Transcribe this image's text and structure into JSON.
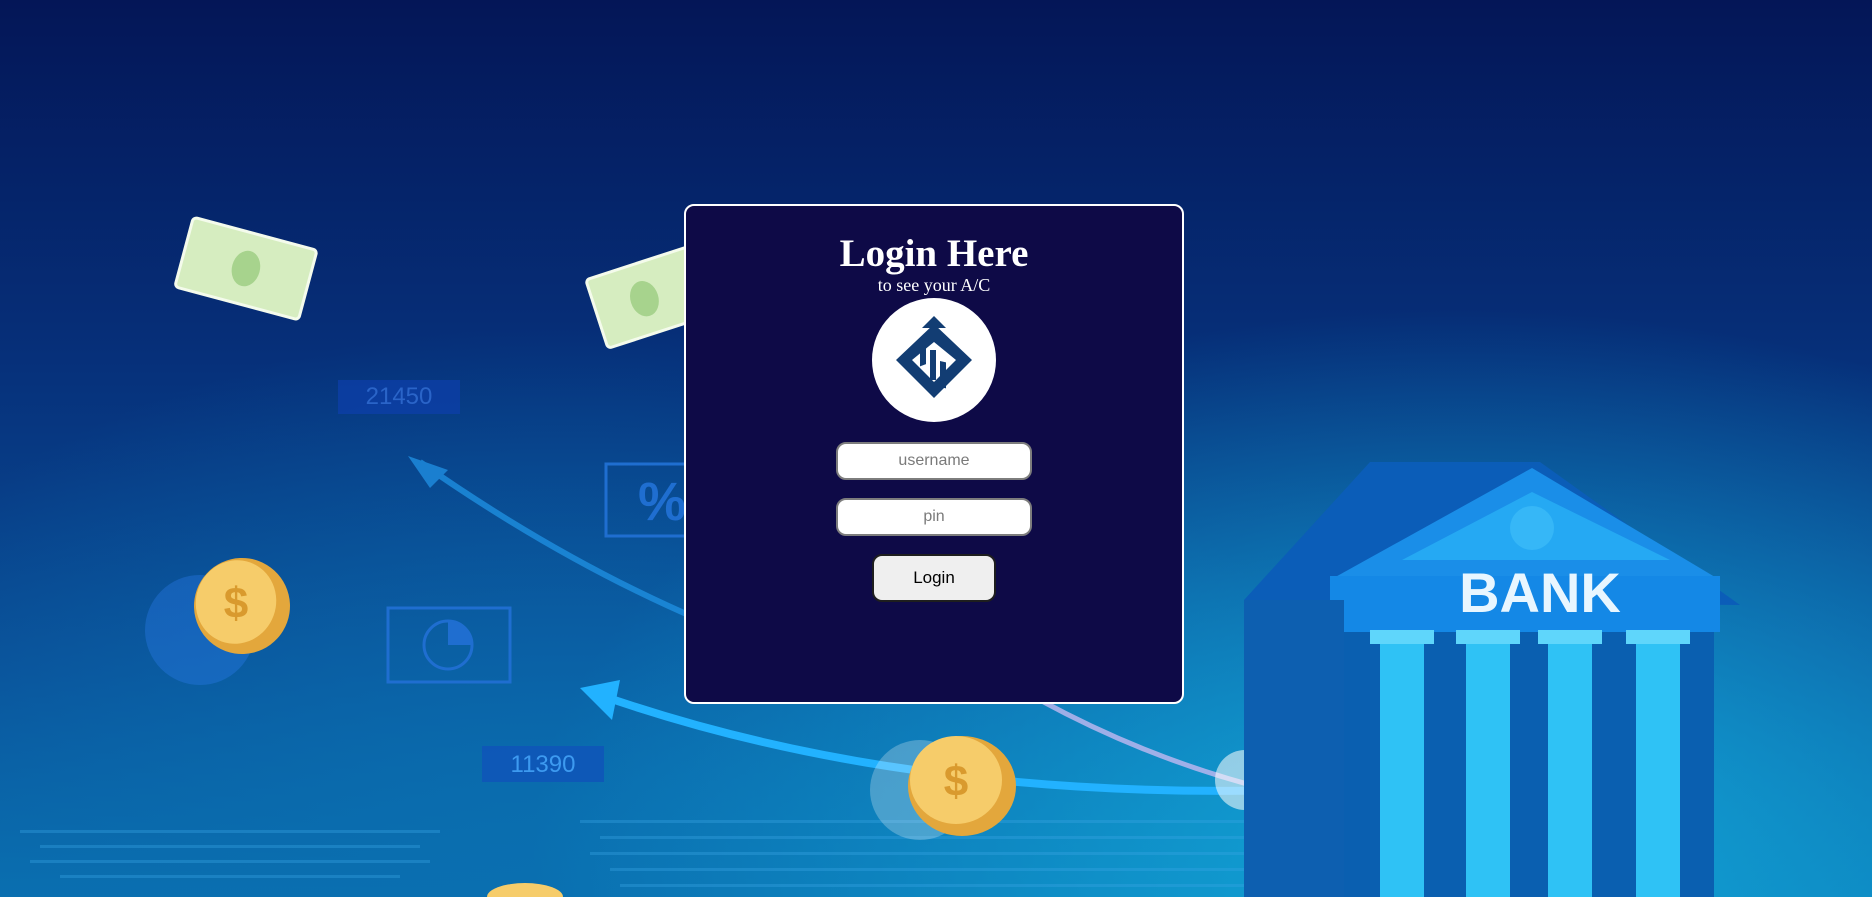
{
  "background": {
    "stat_numbers": [
      "21450",
      "11390"
    ],
    "percent_symbol": "%",
    "coin_symbol": "$",
    "bank_sign": "BANK"
  },
  "login": {
    "title": "Login Here",
    "subtitle": "to see your A/C",
    "logo_icon": "bank-diamond-logo",
    "username_placeholder": "username",
    "pin_placeholder": "pin",
    "button_label": "Login"
  },
  "colors": {
    "card_background": "#0e0a47",
    "logo_blue": "#123d73",
    "page_background": "#06307a"
  }
}
